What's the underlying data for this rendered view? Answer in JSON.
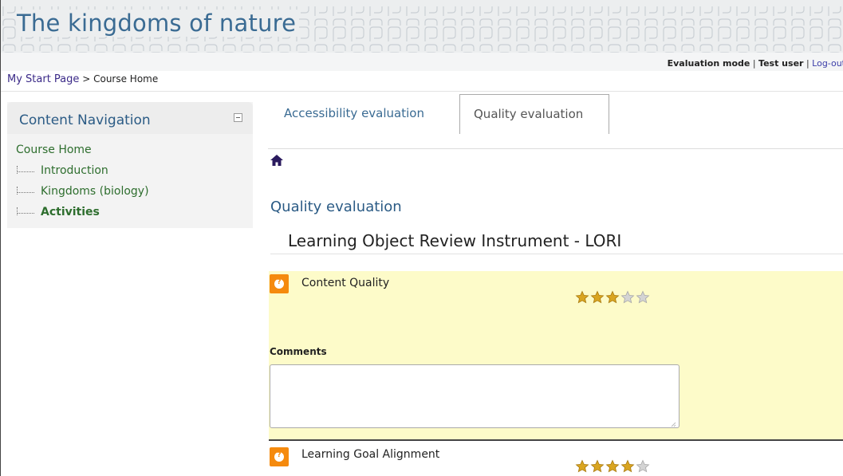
{
  "site": {
    "title": "The kingdoms of nature"
  },
  "userbar": {
    "mode": "Evaluation mode",
    "user": "Test user",
    "logout": "Log-out"
  },
  "breadcrumb": {
    "home": "My Start Page",
    "separator": " > ",
    "current": "Course Home"
  },
  "sidebar": {
    "title": "Content Navigation",
    "home": "Course Home",
    "items": [
      {
        "label": "Introduction"
      },
      {
        "label": "Kingdoms (biology)"
      },
      {
        "label": "Activities"
      }
    ]
  },
  "tabs": {
    "accessibility": "Accessibility evaluation",
    "quality": "Quality evaluation"
  },
  "main": {
    "section_title": "Quality evaluation",
    "instrument_title": "Learning Object Review Instrument - LORI",
    "comments_label": "Comments",
    "criteria": [
      {
        "label": "Content Quality",
        "rating": 3,
        "max": 5
      },
      {
        "label": "Learning Goal Alignment",
        "rating": 4,
        "max": 5
      }
    ]
  },
  "colors": {
    "accent": "#3a6b93",
    "nav_link": "#2e6e2e",
    "criterion_bg": "#fdfbc9",
    "help_icon": "#f58a0e"
  },
  "icons": [
    "collapse-icon",
    "home-icon",
    "help-icon",
    "star-icon",
    "resize-grip-icon"
  ]
}
